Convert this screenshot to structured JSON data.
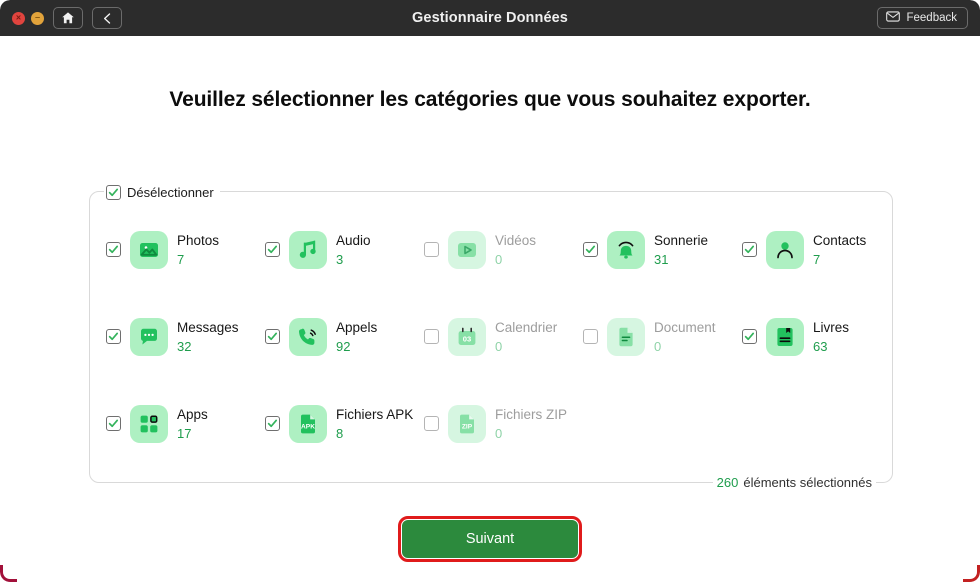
{
  "window": {
    "title": "Gestionnaire Données",
    "close_label": "×",
    "minimize_label": "−",
    "home_icon": "home-icon",
    "back_icon": "chevron-left-icon",
    "feedback_label": "Feedback",
    "feedback_icon": "envelope-icon"
  },
  "main": {
    "headline": "Veuillez sélectionner les catégories que vous souhaitez exporter.",
    "select_all": {
      "label": "Désélectionner",
      "checked": true
    },
    "selected_count": {
      "number": "260",
      "label": "éléments sélectionnés"
    },
    "next_label": "Suivant",
    "accent_green": "#2c8a3d",
    "highlight_red": "#e01b1b",
    "count_green": "#1f9d4d",
    "categories": [
      {
        "name": "Photos",
        "count": "7",
        "checked": true,
        "icon": "photo-icon"
      },
      {
        "name": "Audio",
        "count": "3",
        "checked": true,
        "icon": "music-note-icon"
      },
      {
        "name": "Vidéos",
        "count": "0",
        "checked": false,
        "icon": "video-play-icon"
      },
      {
        "name": "Sonnerie",
        "count": "31",
        "checked": true,
        "icon": "bell-icon"
      },
      {
        "name": "Contacts",
        "count": "7",
        "checked": true,
        "icon": "person-icon"
      },
      {
        "name": "Messages",
        "count": "32",
        "checked": true,
        "icon": "chat-bubble-icon"
      },
      {
        "name": "Appels",
        "count": "92",
        "checked": true,
        "icon": "phone-icon"
      },
      {
        "name": "Calendrier",
        "count": "0",
        "checked": false,
        "icon": "calendar-icon"
      },
      {
        "name": "Document",
        "count": "0",
        "checked": false,
        "icon": "document-icon"
      },
      {
        "name": "Livres",
        "count": "63",
        "checked": true,
        "icon": "book-icon"
      },
      {
        "name": "Apps",
        "count": "17",
        "checked": true,
        "icon": "apps-grid-icon"
      },
      {
        "name": "Fichiers APK",
        "count": "8",
        "checked": true,
        "icon": "apk-file-icon"
      },
      {
        "name": "Fichiers ZIP",
        "count": "0",
        "checked": false,
        "icon": "zip-file-icon"
      }
    ]
  }
}
